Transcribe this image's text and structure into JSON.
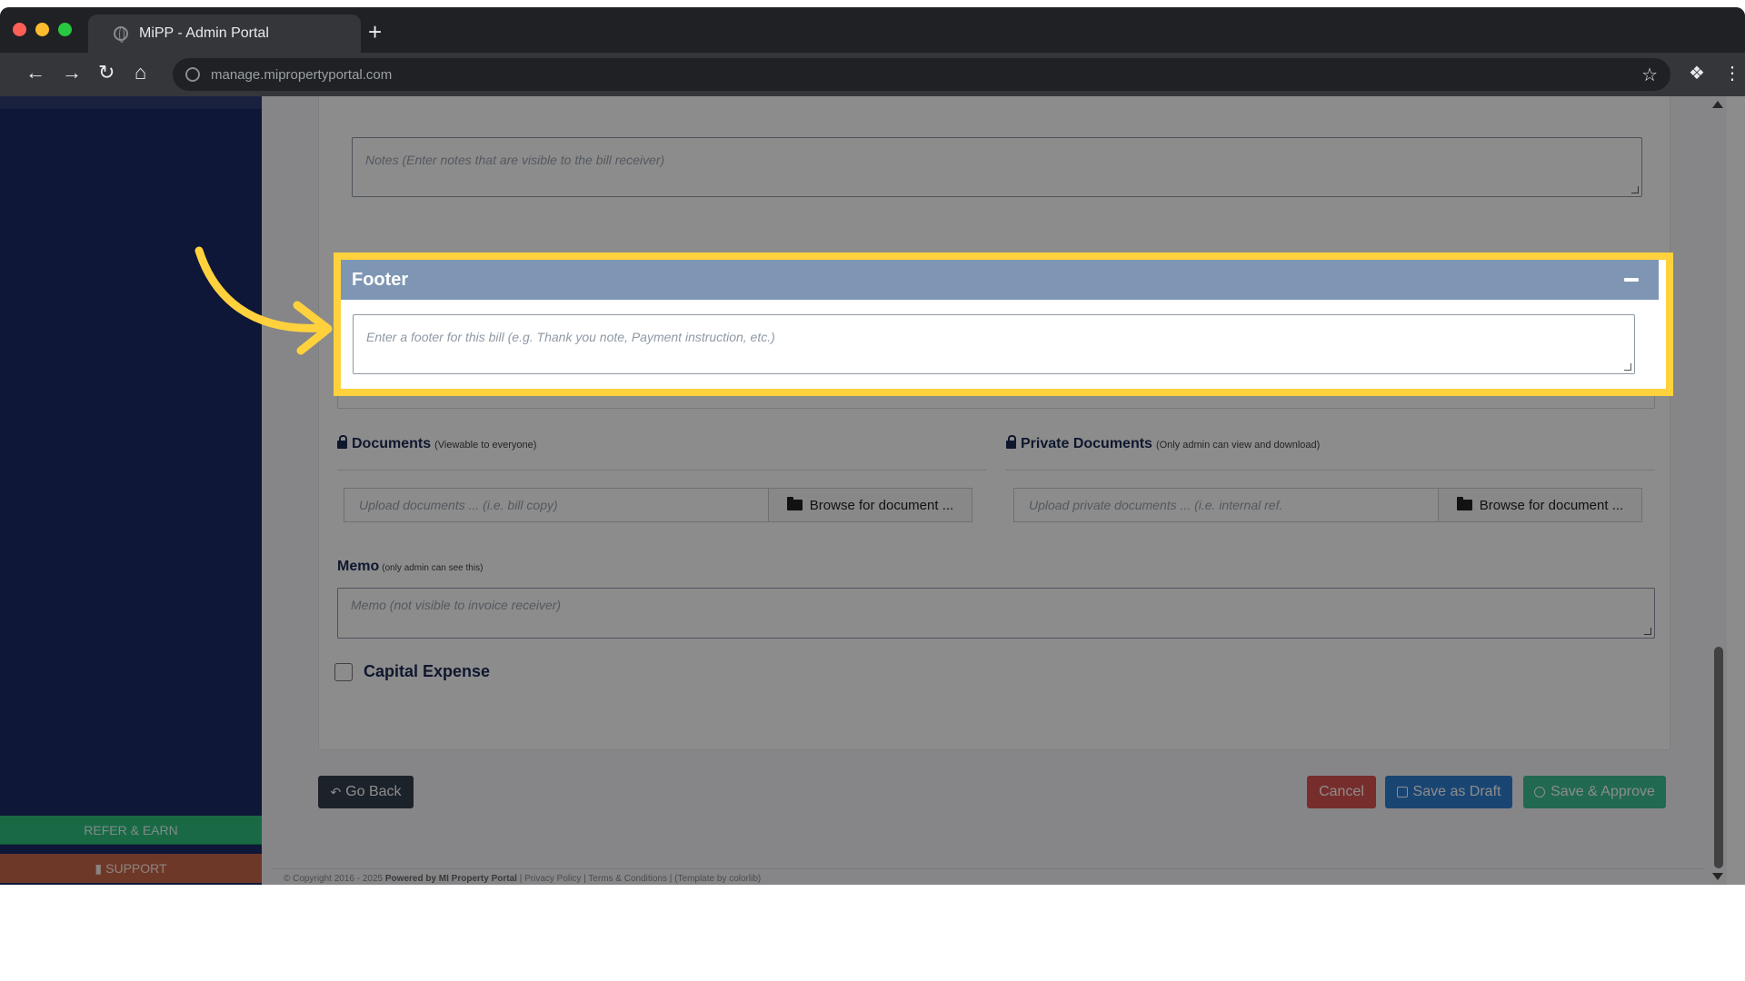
{
  "browser": {
    "tab_title": "MiPP - Admin Portal",
    "new_tab_glyph": "+",
    "url": "manage.mipropertyportal.com"
  },
  "sidebar": {
    "refer_label": "REFER & EARN",
    "support_label": "SUPPORT"
  },
  "form": {
    "notes_placeholder": "Notes (Enter notes that are visible to the bill receiver)",
    "footer": {
      "title": "Footer",
      "placeholder": "Enter a footer for this bill (e.g. Thank you note, Payment instruction, etc.)"
    },
    "documents": {
      "title": "Documents",
      "note": "(Viewable to everyone)",
      "placeholder": "Upload documents ... (i.e. bill copy)",
      "browse_label": "Browse for document ..."
    },
    "private_documents": {
      "title": "Private Documents",
      "note": "(Only admin can view and download)",
      "placeholder": "Upload private documents ... (i.e. internal ref.",
      "browse_label": "Browse for document ..."
    },
    "memo": {
      "title": "Memo",
      "note": "(only admin can see this)",
      "placeholder": "Memo (not visible to invoice receiver)"
    },
    "capital_expense_label": "Capital Expense"
  },
  "actions": {
    "go_back": "Go Back",
    "cancel": "Cancel",
    "save_draft": "Save as Draft",
    "save_approve": "Save & Approve"
  },
  "copyright": {
    "prefix": "© Copyright 2016 - 2025",
    "powered": "Powered by MI Property Portal",
    "links": "| Privacy Policy | Terms & Conditions |",
    "template": "(Template by colorlib)"
  },
  "colors": {
    "highlight": "#ffd23d",
    "sidebar": "#1a2a66",
    "panel_header": "#7e96b4"
  }
}
